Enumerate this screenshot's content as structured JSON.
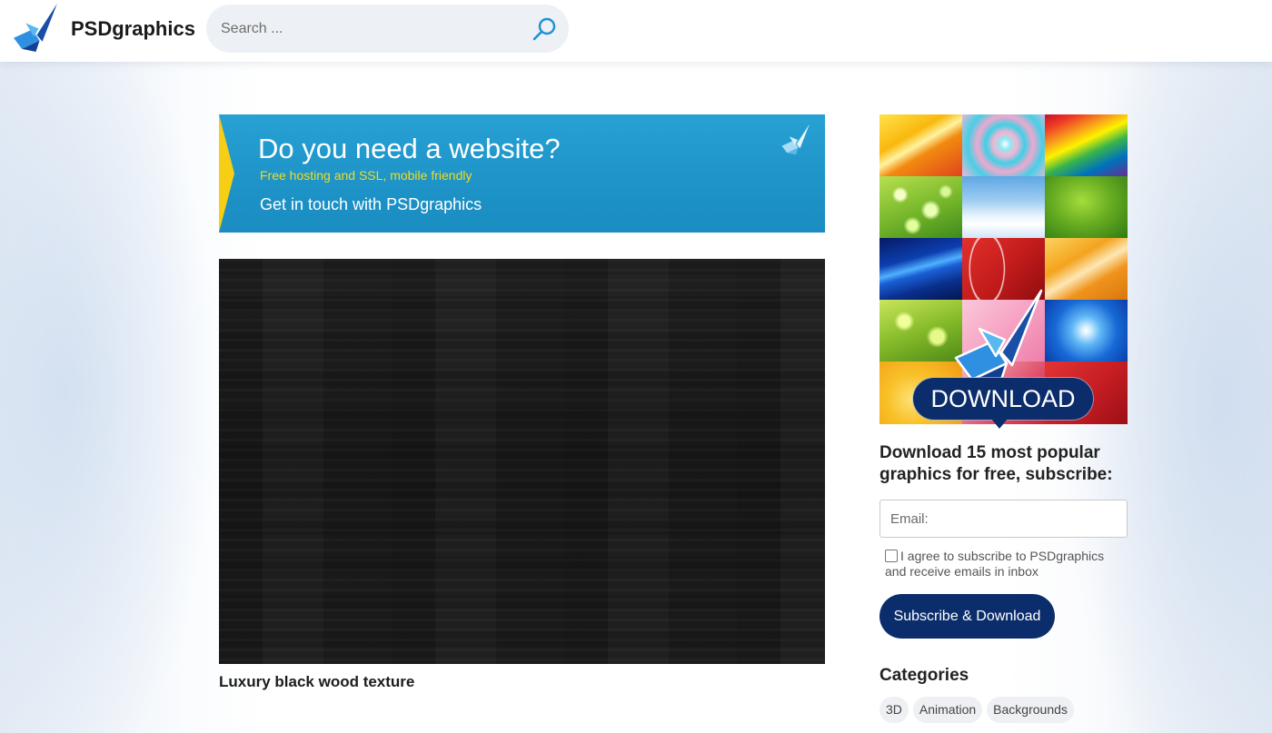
{
  "header": {
    "logo_text": "PSDgraphics",
    "search_placeholder": "Search ..."
  },
  "banner": {
    "headline": "Do you need a website?",
    "subline": "Free hosting and SSL, mobile friendly",
    "cta": "Get in touch with PSDgraphics"
  },
  "post": {
    "title": "Luxury black wood texture"
  },
  "sidebar": {
    "promo_button": "DOWNLOAD",
    "subscribe_heading": "Download 15 most popular graphics for free, subscribe:",
    "email_placeholder": "Email:",
    "agree_text": "I agree to subscribe to PSDgraphics and receive emails in inbox",
    "agree_checked": false,
    "submit_label": "Subscribe & Download",
    "categories_heading": "Categories",
    "categories": [
      "3D",
      "Animation",
      "Backgrounds"
    ]
  },
  "icons": {
    "logo": "psdgraphics-logo-icon",
    "search": "search-icon",
    "banner_logo": "psdgraphics-logo-icon",
    "promo_logo": "psdgraphics-logo-icon"
  },
  "colors": {
    "brand_navy": "#0c2d6b",
    "banner_blue": "#1e94c8",
    "banner_accent_yellow": "#f6cf14",
    "banner_subline_yellow": "#f3dc1e",
    "search_icon_blue": "#1e90d6",
    "search_bg": "#edf0f4",
    "chip_bg": "#eef0f3"
  }
}
